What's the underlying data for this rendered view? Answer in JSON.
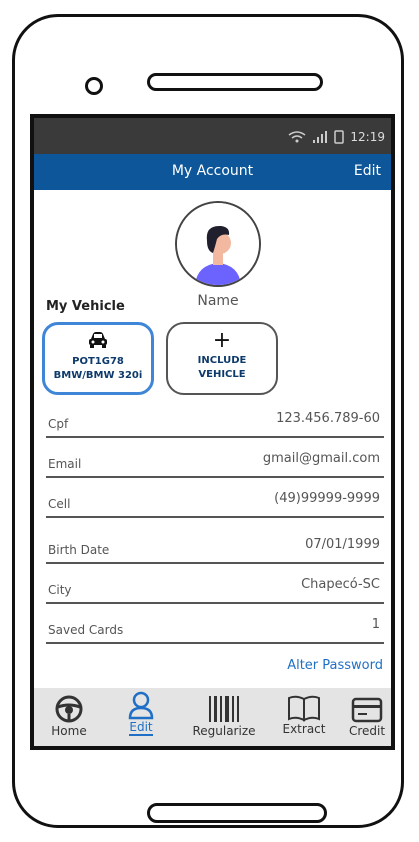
{
  "status_bar": {
    "time": "12:19"
  },
  "app_bar": {
    "title": "My Account",
    "edit_label": "Edit"
  },
  "profile": {
    "name": "Name"
  },
  "vehicles": {
    "section_label": "My Vehicle",
    "card": {
      "plate": "POT1G78",
      "model": "BMW/BMW 320i"
    },
    "include_line1": "INCLUDE",
    "include_line2": "VEHICLE"
  },
  "fields": [
    {
      "label": "Cpf",
      "value": "123.456.789-60"
    },
    {
      "label": "Email",
      "value": "gmail@gmail.com"
    },
    {
      "label": "Cell",
      "value": "(49)99999-9999"
    },
    {
      "label": "Birth Date",
      "value": "07/01/1999"
    },
    {
      "label": "City",
      "value": "Chapecó-SC"
    },
    {
      "label": "Saved Cards",
      "value": "1"
    }
  ],
  "alter_password": "Alter Password",
  "nav": [
    {
      "label": "Home",
      "icon": "steering-wheel-icon"
    },
    {
      "label": "Edit",
      "icon": "user-icon"
    },
    {
      "label": "Regularize",
      "icon": "barcode-icon"
    },
    {
      "label": "Extract",
      "icon": "book-icon"
    },
    {
      "label": "Credit",
      "icon": "credit-card-icon"
    }
  ],
  "colors": {
    "app_bar": "#0d5699",
    "accent": "#1f6fc6",
    "status_bar": "#3a3a3a"
  }
}
